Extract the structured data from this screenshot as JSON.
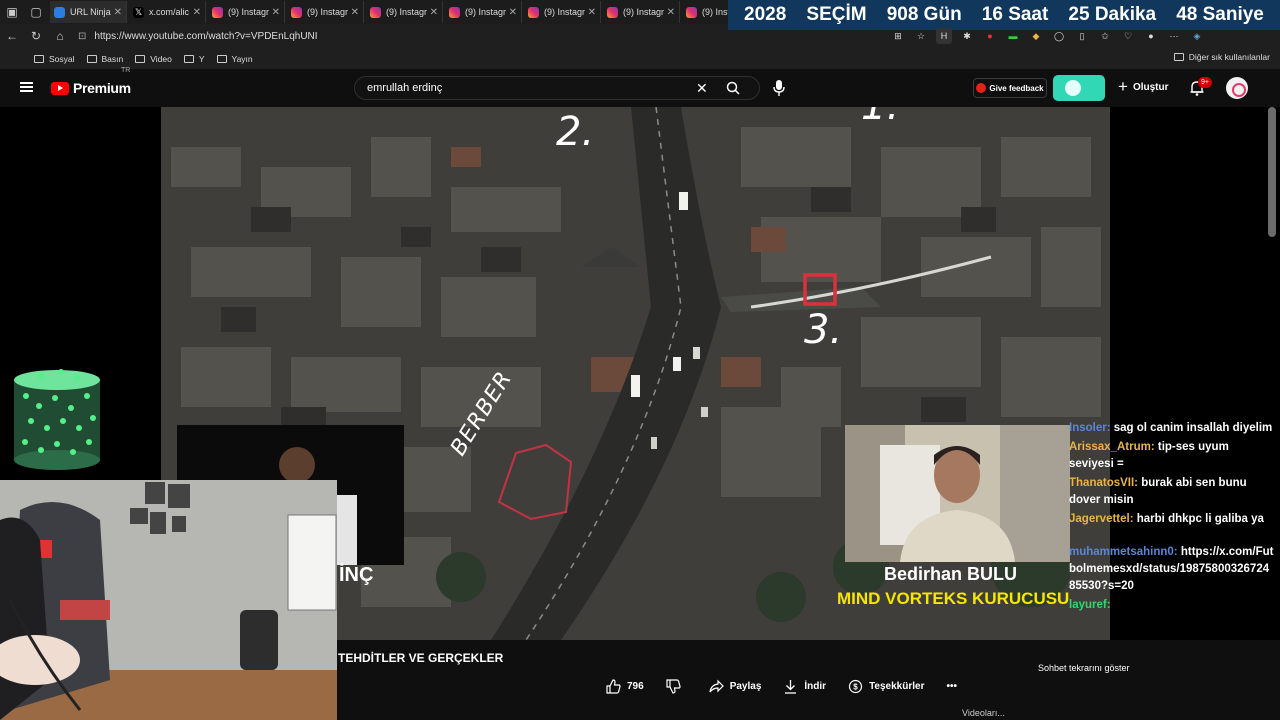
{
  "browser": {
    "tabs": [
      {
        "label": "URL Ninja",
        "icon": "url-ninja-icon"
      },
      {
        "label": "x.com/alic",
        "icon": "x-icon"
      },
      {
        "label": "(9) Instagr",
        "icon": "instagram-icon"
      },
      {
        "label": "(9) Instagr",
        "icon": "instagram-icon"
      },
      {
        "label": "(9) Instagr",
        "icon": "instagram-icon"
      },
      {
        "label": "(9) Instagr",
        "icon": "instagram-icon"
      },
      {
        "label": "(9) Instagr",
        "icon": "instagram-icon"
      },
      {
        "label": "(9) Instagr",
        "icon": "instagram-icon"
      },
      {
        "label": "(9) Instagr",
        "icon": "instagram-icon"
      }
    ],
    "url": "https://www.youtube.com/watch?v=VPDEnLqhUNI",
    "bookmarks": [
      "Sosyal",
      "Basın",
      "Video",
      "Y",
      "Yayın"
    ],
    "other_bookmarks": "Diğer sık kullanılanlar"
  },
  "countdown": {
    "year": "2028",
    "label": "SEÇİM",
    "days": "908 Gün",
    "hours": "16 Saat",
    "minutes": "25 Dakika",
    "seconds": "48 Saniye",
    "bg_color": "#12375d"
  },
  "youtube": {
    "logo": "Premium",
    "region": "TR",
    "search_value": "emrullah erdinç",
    "feedback": "Give feedback",
    "create": "Oluştur",
    "notifications": "9+"
  },
  "video": {
    "map_labels": {
      "two": "2.",
      "three": "3.",
      "barber": "BERBER",
      "one": "1."
    },
    "speaker_partial": "İNÇ",
    "guest_name": "Bedirhan BULU",
    "guest_role": "MIND VORTEKS KURUCUSU",
    "title": "TEHDİTLER VE GERÇEKLER"
  },
  "chat": [
    {
      "user": "Insoler:",
      "text": "sag ol canim insallah diyelim",
      "color": "blue"
    },
    {
      "user": "Arissax_Atrum:",
      "text": "tip-ses uyum seviyesi =",
      "color": "gold"
    },
    {
      "user": "ThanatosVII:",
      "text": "burak abi sen bunu dover misin",
      "color": "gold"
    },
    {
      "user": "Jagervettel:",
      "text": "harbi dhkpc li galiba ya",
      "color": "gold"
    },
    {
      "user": "muhammetsahinn0:",
      "text": "https://x.com/Futbolmemesxd/status/1987580032672485530?s=20",
      "color": "blue"
    },
    {
      "user": "layuref:",
      "text": "",
      "color": "green"
    }
  ],
  "chat_overlay": "Sohbet tekrarını göster",
  "actions": {
    "likes": "796",
    "share": "Paylaş",
    "download": "İndir",
    "thanks": "Teşekkürler",
    "more": "•••"
  },
  "bottom_hint": "Videoları..."
}
